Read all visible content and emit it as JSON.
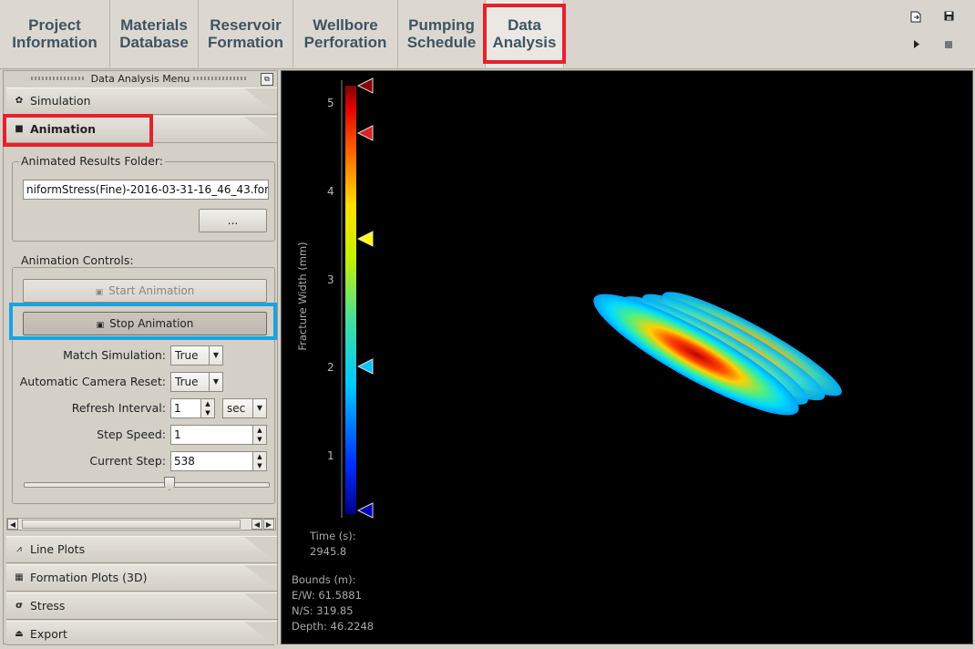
{
  "tabs": [
    {
      "label": "Project\nInformation"
    },
    {
      "label": "Materials\nDatabase"
    },
    {
      "label": "Reservoir\nFormation"
    },
    {
      "label": "Wellbore\nPerforation"
    },
    {
      "label": "Pumping\nSchedule"
    },
    {
      "label": "Data\nAnalysis"
    }
  ],
  "toolbar": {
    "icons": [
      "export-icon",
      "save-icon",
      "play-icon",
      "stop-icon"
    ]
  },
  "panel": {
    "title": "Data Analysis Menu",
    "sections_top": [
      {
        "label": "Simulation",
        "icon": "gear-icon"
      },
      {
        "label": "Animation",
        "icon": "camera-icon"
      }
    ],
    "folder_group": "Animated Results Folder:",
    "folder_value": "niformStress(Fine)-2016-03-31-16_46_43.for",
    "browse_label": "...",
    "controls_group": "Animation Controls:",
    "start_label": "Start Animation",
    "stop_label": "Stop Animation",
    "fields": {
      "match_simulation_label": "Match Simulation:",
      "match_simulation_value": "True",
      "auto_camera_label": "Automatic Camera Reset:",
      "auto_camera_value": "True",
      "refresh_label": "Refresh Interval:",
      "refresh_value": "1",
      "refresh_unit": "sec",
      "step_speed_label": "Step Speed:",
      "step_speed_value": "1",
      "current_step_label": "Current Step:",
      "current_step_value": "538"
    },
    "sections_bottom": [
      {
        "label": "Line Plots",
        "icon": "line-chart-icon"
      },
      {
        "label": "Formation Plots (3D)",
        "icon": "grid-icon"
      },
      {
        "label": "Stress",
        "icon": "sigma-icon"
      },
      {
        "label": "Export",
        "icon": "export-icon"
      }
    ]
  },
  "viewport": {
    "colorbar_title": "Fracture Width (mm)",
    "ticks": [
      "5",
      "4",
      "3",
      "2",
      "1"
    ],
    "time_label": "Time (s):",
    "time_value": "2945.8",
    "bounds_label": "Bounds (m):",
    "ew": "E/W: 61.5881",
    "ns": "N/S: 319.85",
    "depth": "Depth: 46.2248"
  },
  "colors": {
    "highlight_red": "#e8202a",
    "highlight_blue": "#1aa3e0",
    "tab_text": "#3d5462"
  }
}
